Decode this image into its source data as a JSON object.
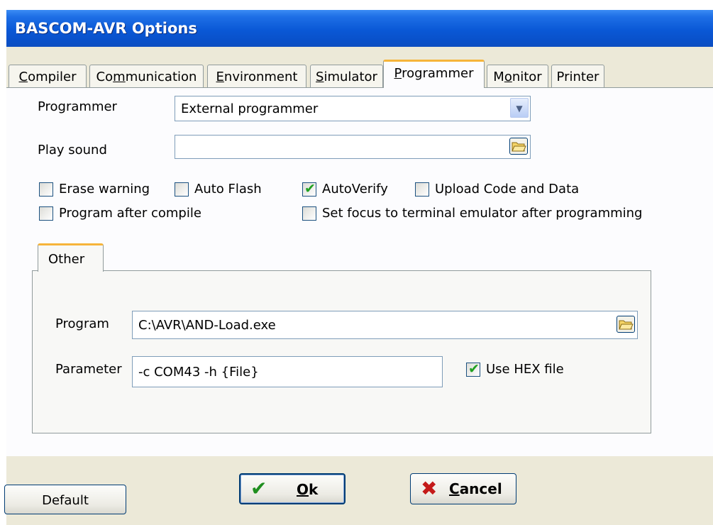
{
  "window": {
    "title": "BASCOM-AVR Options"
  },
  "tabs": [
    {
      "key": "C",
      "rest": "ompiler"
    },
    {
      "key": "",
      "pre": "Co",
      "mid": "m",
      "rest": "munication"
    },
    {
      "key": "E",
      "rest": "nvironment"
    },
    {
      "key": "S",
      "rest": "imulator"
    },
    {
      "key": "P",
      "rest": "rogrammer"
    },
    {
      "pre": "M",
      "mid": "o",
      "rest": "nitor"
    },
    {
      "label": "Printer"
    }
  ],
  "programmer": {
    "programmer_label": "Programmer",
    "programmer_value": "External programmer",
    "play_sound_label": "Play sound",
    "play_sound_value": "",
    "checkboxes": {
      "erase_warning": {
        "label": "Erase warning",
        "checked": false
      },
      "auto_flash": {
        "label": "Auto Flash",
        "checked": false
      },
      "auto_verify": {
        "label": "AutoVerify",
        "checked": true
      },
      "upload_code_data": {
        "label": "Upload Code and Data",
        "checked": false
      },
      "program_after_compile": {
        "label": "Program after compile",
        "checked": false
      },
      "set_focus_terminal": {
        "label": "Set focus to terminal emulator after programming",
        "checked": false
      }
    },
    "other": {
      "tab_label": "Other",
      "program_label": "Program",
      "program_value": "C:\\AVR\\AND-Load.exe",
      "parameter_label": "Parameter",
      "parameter_value": "-c COM43 -h {File}",
      "use_hex": {
        "label": "Use HEX file",
        "checked": true
      }
    }
  },
  "buttons": {
    "default": "Default",
    "ok_key": "O",
    "ok_rest": "k",
    "cancel_key": "C",
    "cancel_rest": "ancel"
  }
}
